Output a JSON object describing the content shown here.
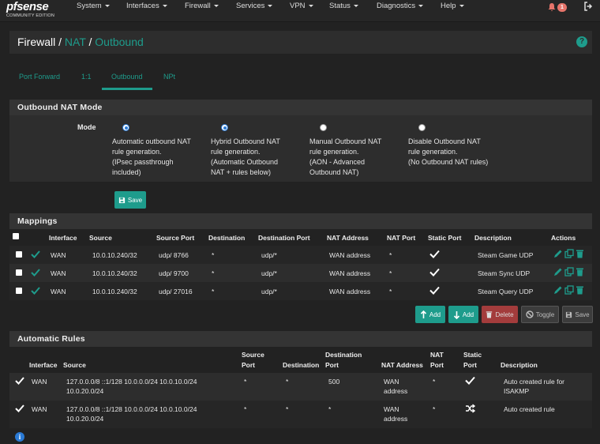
{
  "brand": {
    "logo": "pfsense",
    "edition": "COMMUNITY EDITION"
  },
  "nav": [
    "System",
    "Interfaces",
    "Firewall",
    "Services",
    "VPN",
    "Status",
    "Diagnostics",
    "Help"
  ],
  "notifications": {
    "count": "1",
    "icon": "bell-icon"
  },
  "breadcrumb": {
    "root": "Firewall",
    "sep": "/",
    "mid": "NAT",
    "leaf": "Outbound"
  },
  "tabs": [
    "Port Forward",
    "1:1",
    "Outbound",
    "NPt"
  ],
  "active_tab": "Outbound",
  "outbound_mode": {
    "title": "Outbound NAT Mode",
    "label": "Mode",
    "options": [
      {
        "text": "Automatic outbound NAT\nrule generation.\n(IPsec passthrough\nincluded)",
        "checked": true
      },
      {
        "text": "Hybrid Outbound NAT\nrule generation.\n(Automatic Outbound\nNAT + rules below)",
        "checked": true
      },
      {
        "text": "Manual Outbound NAT\nrule generation.\n(AON - Advanced\nOutbound NAT)",
        "checked": false
      },
      {
        "text": "Disable Outbound NAT\nrule generation.\n(No Outbound NAT rules)",
        "checked": false
      }
    ],
    "save_label": "Save"
  },
  "mappings": {
    "title": "Mappings",
    "headers": [
      "Interface",
      "Source",
      "Source Port",
      "Destination",
      "Destination Port",
      "NAT Address",
      "NAT Port",
      "Static Port",
      "Description",
      "Actions"
    ],
    "rows": [
      {
        "interface": "WAN",
        "source": "10.0.10.240/32",
        "source_port": "udp/ 8766",
        "destination": "*",
        "destination_port": "udp/*",
        "nat_address": "WAN address",
        "nat_port": "*",
        "description": "Steam Game UDP"
      },
      {
        "interface": "WAN",
        "source": "10.0.10.240/32",
        "source_port": "udp/ 9700",
        "destination": "*",
        "destination_port": "udp/*",
        "nat_address": "WAN address",
        "nat_port": "*",
        "description": "Steam Sync UDP"
      },
      {
        "interface": "WAN",
        "source": "10.0.10.240/32",
        "source_port": "udp/ 27016",
        "destination": "*",
        "destination_port": "udp/*",
        "nat_address": "WAN address",
        "nat_port": "*",
        "description": "Steam Query UDP"
      }
    ],
    "buttons": {
      "add_top": "Add",
      "add_bottom": "Add",
      "delete": "Delete",
      "toggle": "Toggle",
      "save": "Save"
    }
  },
  "auto_rules": {
    "title": "Automatic Rules",
    "headers": {
      "interface": "Interface",
      "source": "Source",
      "source_port_1": "Source",
      "source_port_2": "Port",
      "destination": "Destination",
      "dest_port_1": "Destination",
      "dest_port_2": "Port",
      "nat_address": "NAT Address",
      "nat_port_1": "NAT",
      "nat_port_2": "Port",
      "static_port_1": "Static",
      "static_port_2": "Port",
      "description": "Description"
    },
    "rows": [
      {
        "interface": "WAN",
        "source_1": "127.0.0.0/8 ::1/128 10.0.0.0/24 10.0.10.0/24",
        "source_2": "10.0.20.0/24",
        "source_port": "*",
        "destination": "*",
        "dest_port": "500",
        "nat_address_1": "WAN",
        "nat_address_2": "address",
        "nat_port": "*",
        "description_1": "Auto created rule for",
        "description_2": "ISAKMP"
      },
      {
        "interface": "WAN",
        "source_1": "127.0.0.0/8 ::1/128 10.0.0.0/24 10.0.10.0/24",
        "source_2": "10.0.20.0/24",
        "source_port": "*",
        "destination": "*",
        "dest_port": "*",
        "nat_address_1": "WAN",
        "nat_address_2": "address",
        "nat_port": "*",
        "description_1": "Auto created rule",
        "description_2": ""
      }
    ]
  },
  "colors": {
    "accent": "#1e9c8c",
    "danger": "#a33c3c",
    "background": "#222222",
    "panel": "#343434"
  }
}
